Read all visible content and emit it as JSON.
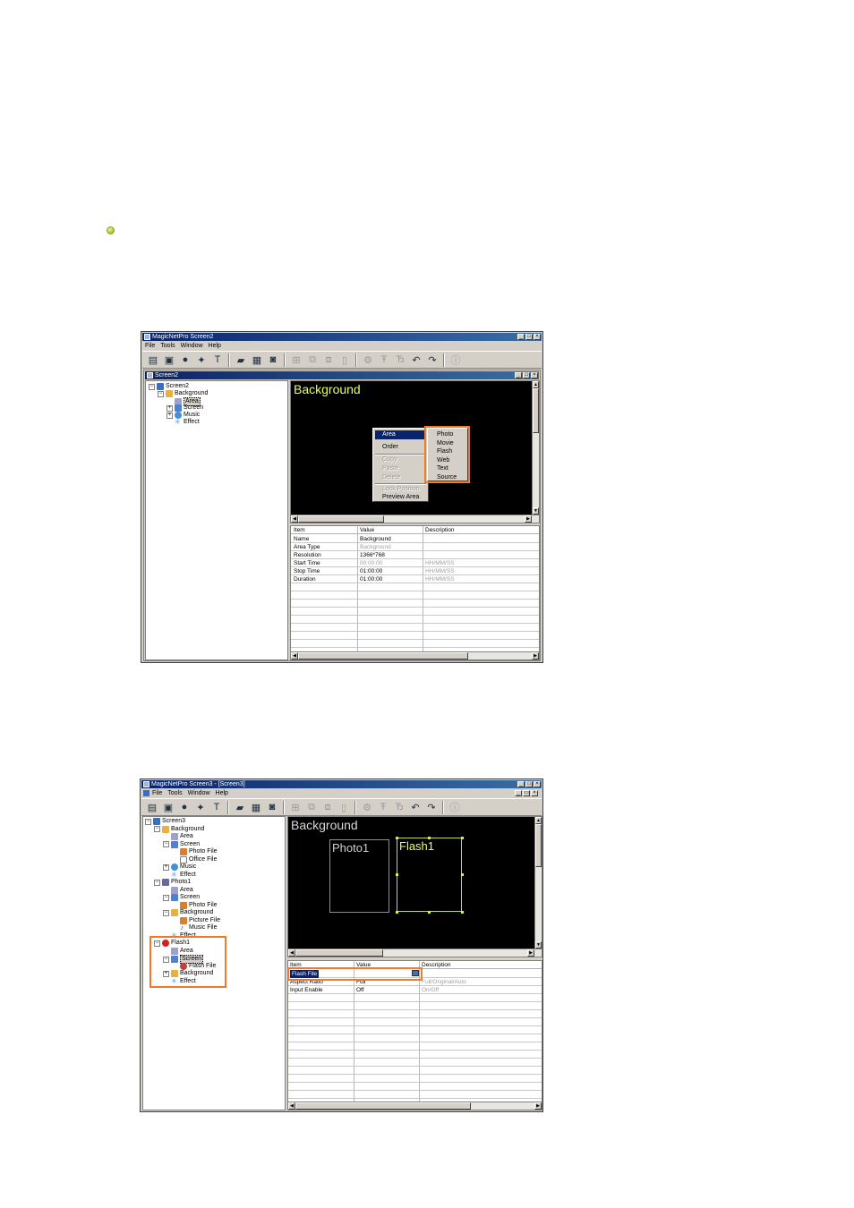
{
  "screenshot1": {
    "title": "MagicNetPro Screen2",
    "menu": [
      "File",
      "Tools",
      "Window",
      "Help"
    ],
    "child_title": "Screen2",
    "tree": {
      "root": "Screen2",
      "background": "Background",
      "area": "Area",
      "screen": "Screen",
      "music": "Music",
      "effect": "Effect"
    },
    "preview_title": "Background",
    "context_menu": {
      "area": "Area",
      "order": "Order",
      "copy": "Copy",
      "paste": "Paste",
      "delete": "Delete",
      "lock_position": "Lock Position",
      "preview_area": "Preview Area"
    },
    "submenu": [
      "Photo",
      "Movie",
      "Flash",
      "Web",
      "Text",
      "Source"
    ],
    "grid": {
      "headers": [
        "Item",
        "Value",
        "Description"
      ],
      "rows": [
        [
          "Name",
          "Background",
          ""
        ],
        [
          "Area Type",
          "Background",
          ""
        ],
        [
          "Resolution",
          "1366*768",
          ""
        ],
        [
          "Start Time",
          "00:00:00",
          "HH/MM/SS"
        ],
        [
          "Stop Time",
          "01:00:00",
          "HH/MM/SS"
        ],
        [
          "Duration",
          "01:00:00",
          "HH/MM/SS"
        ]
      ]
    }
  },
  "screenshot2": {
    "title": "MagicNetPro Screen3 - [Screen3]",
    "menu": [
      "File",
      "Tools",
      "Window",
      "Help"
    ],
    "tree": {
      "root": "Screen3",
      "background": "Background",
      "area": "Area",
      "screen": "Screen",
      "photo_file": "Photo File",
      "office_file": "Office File",
      "music": "Music",
      "effect": "Effect",
      "photo1": "Photo1",
      "p_area": "Area",
      "p_screen": "Screen",
      "p_photo_file": "Photo File",
      "p_background": "Background",
      "p_picture_file": "Picture File",
      "p_music_file": "Music File",
      "p_effect": "Effect",
      "flash1": "Flash1",
      "f_area": "Area",
      "f_screen": "Screen",
      "f_flash_file": "Flash File",
      "f_background": "Background",
      "f_effect": "Effect"
    },
    "preview_title": "Background",
    "photo_label": "Photo1",
    "flash_label": "Flash1",
    "grid": {
      "headers": [
        "Item",
        "Value",
        "Description"
      ],
      "rows": [
        [
          "Flash File",
          "",
          ""
        ],
        [
          "Aspect Ratio",
          "Full",
          "Full/Original/Auto"
        ],
        [
          "Input Enable",
          "Off",
          "On/Off"
        ]
      ]
    }
  },
  "colors": {
    "accent_highlight": "#f07a2a",
    "title_bar": "#0a246a",
    "preview_text": "#e8ff60"
  }
}
